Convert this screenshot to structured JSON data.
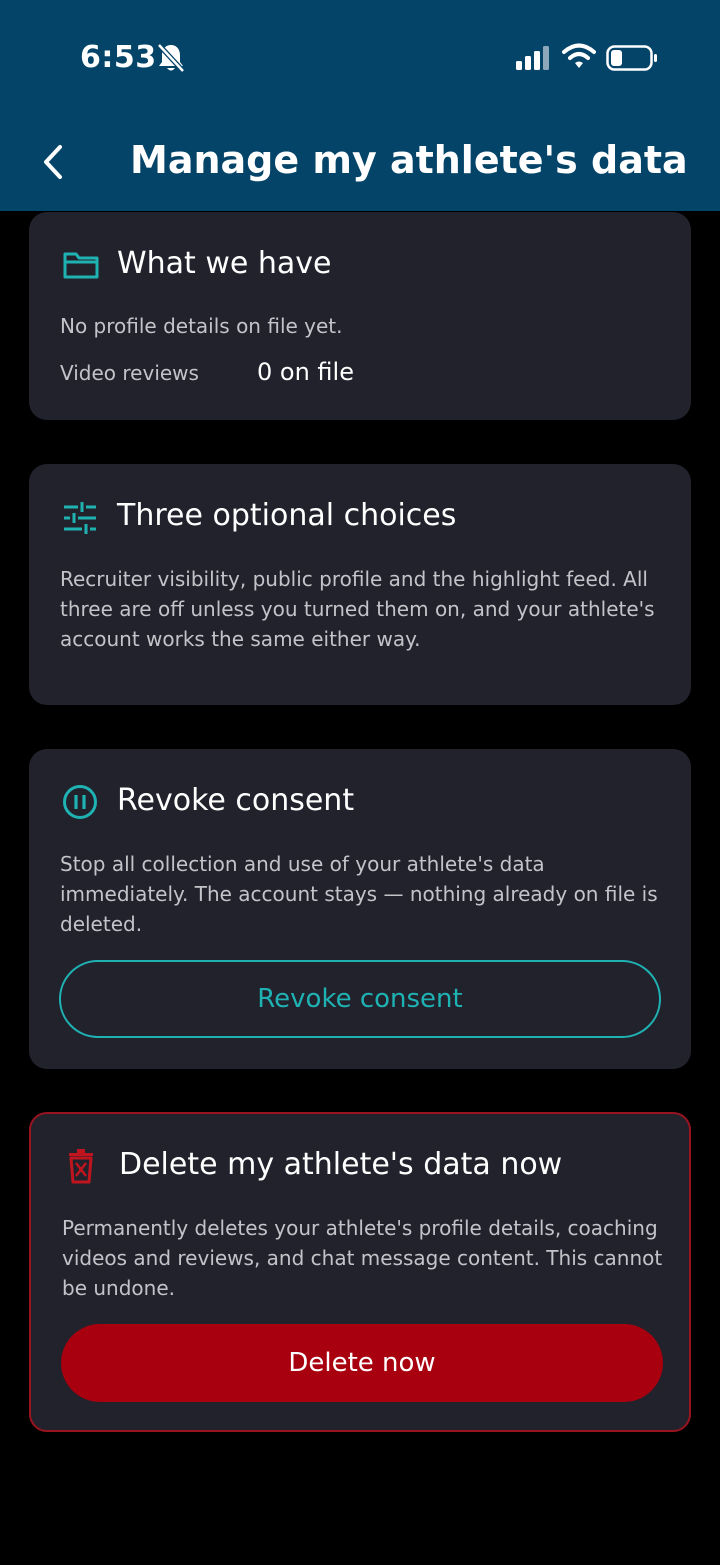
{
  "status_bar": {
    "time": "6:53",
    "icons": [
      "bell-slash-icon",
      "signal-icon",
      "wifi-icon",
      "battery-icon"
    ]
  },
  "header": {
    "back_icon": "chevron-left-icon",
    "title": "Manage my athlete's data"
  },
  "colors": {
    "header_bg": "#044468",
    "card_bg": "#22222d",
    "accent": "#1fb2b3",
    "danger": "#a8000e",
    "danger_border": "#9a1420"
  },
  "cards": {
    "what_we_have": {
      "icon": "folder-icon",
      "title": "What we have",
      "profile_text": "No profile details on file yet.",
      "video_label": "Video reviews",
      "video_value": "0 on file"
    },
    "choices": {
      "icon": "sliders-icon",
      "title": "Three optional choices",
      "body": "Recruiter visibility, public profile and the highlight feed. All three are off unless you turned them on, and your athlete's account works the same either way."
    },
    "revoke": {
      "icon": "pause-circle-icon",
      "title": "Revoke consent",
      "body": "Stop all collection and use of your athlete's data immediately. The account stays — nothing already on file is deleted.",
      "button": "Revoke consent"
    },
    "delete": {
      "icon": "trash-x-icon",
      "title": "Delete my athlete's data now",
      "body": "Permanently deletes your athlete's profile details, coaching videos and reviews, and chat message content. This cannot be undone.",
      "button": "Delete now"
    }
  }
}
